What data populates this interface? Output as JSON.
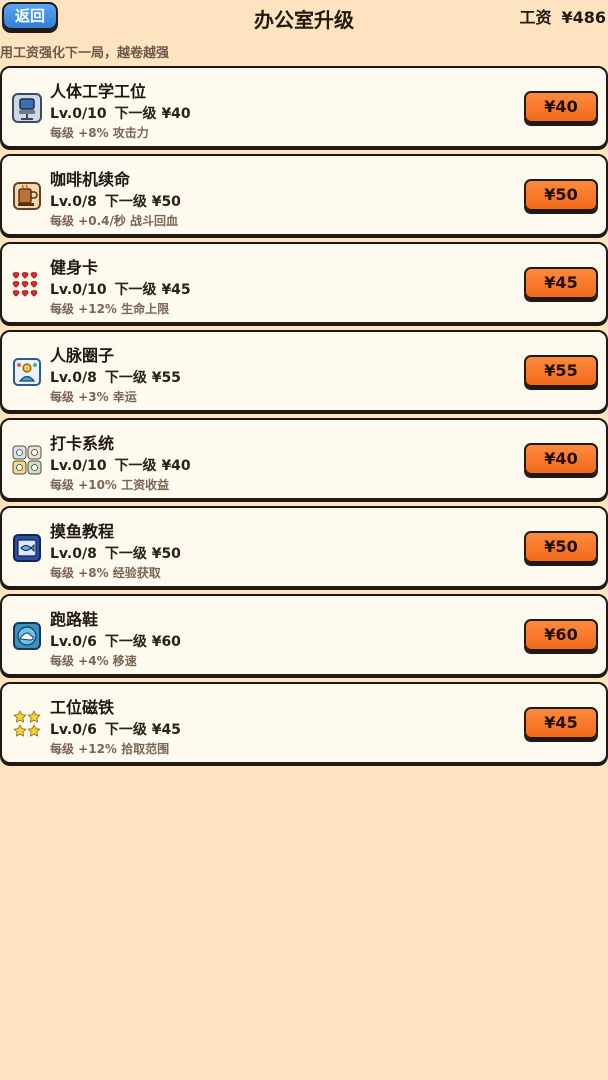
{
  "header": {
    "back_label": "返回",
    "title": "办公室升级",
    "salary_label": "工资",
    "salary_value": "¥486"
  },
  "subtitle": "用工资强化下一局，越卷越强",
  "level_next_label": "下一级",
  "upgrades": [
    {
      "name": "人体工学工位",
      "level": "Lv.0/10",
      "next_cost": "¥40",
      "effect": "每级 +8% 攻击力",
      "price": "¥40",
      "icon": "ergonomic-chair-icon"
    },
    {
      "name": "咖啡机续命",
      "level": "Lv.0/8",
      "next_cost": "¥50",
      "effect": "每级 +0.4/秒 战斗回血",
      "price": "¥50",
      "icon": "coffee-machine-icon"
    },
    {
      "name": "健身卡",
      "level": "Lv.0/10",
      "next_cost": "¥45",
      "effect": "每级 +12% 生命上限",
      "price": "¥45",
      "icon": "hearts-icon"
    },
    {
      "name": "人脉圈子",
      "level": "Lv.0/8",
      "next_cost": "¥55",
      "effect": "每级 +3% 幸运",
      "price": "¥55",
      "icon": "network-card-icon"
    },
    {
      "name": "打卡系统",
      "level": "Lv.0/10",
      "next_cost": "¥40",
      "effect": "每级 +10% 工资收益",
      "price": "¥40",
      "icon": "clock-in-icon"
    },
    {
      "name": "摸鱼教程",
      "level": "Lv.0/8",
      "next_cost": "¥50",
      "effect": "每级 +8% 经验获取",
      "price": "¥50",
      "icon": "fish-book-icon"
    },
    {
      "name": "跑路鞋",
      "level": "Lv.0/6",
      "next_cost": "¥60",
      "effect": "每级 +4% 移速",
      "price": "¥60",
      "icon": "running-shoe-icon"
    },
    {
      "name": "工位磁铁",
      "level": "Lv.0/6",
      "next_cost": "¥45",
      "effect": "每级 +12% 拾取范围",
      "price": "¥45",
      "icon": "stars-magnet-icon"
    }
  ],
  "colors": {
    "background": "#fde3c0",
    "card": "#fffaef",
    "buy_button": "#f47324",
    "back_button": "#3d8fe0",
    "outline": "#1f1a16"
  }
}
